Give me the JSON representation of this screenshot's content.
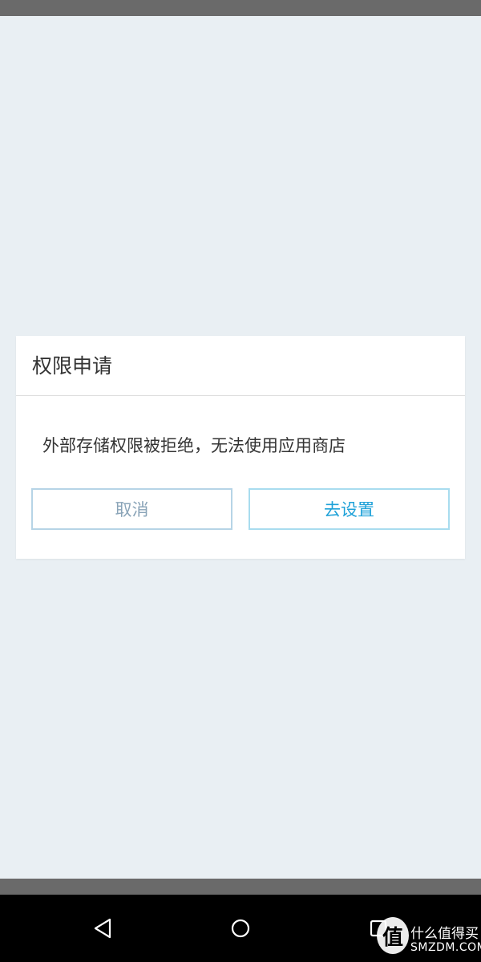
{
  "dialog": {
    "title": "权限申请",
    "message": "外部存储权限被拒绝，无法使用应用商店",
    "cancel_label": "取消",
    "settings_label": "去设置"
  },
  "watermark": {
    "logo_char": "值",
    "cn_text": "什么值得买",
    "en_text": "SMZDM.COM"
  },
  "icons": {
    "nav_back": "back-triangle-icon",
    "nav_home": "home-circle-icon",
    "nav_recent": "recent-apps-square-icon"
  },
  "colors": {
    "background": "#e9eff3",
    "accent": "#1ea1d8",
    "cancel_text": "#8aa4b8",
    "status_bar": "#6a6a6a",
    "nav_bar": "#000000"
  }
}
